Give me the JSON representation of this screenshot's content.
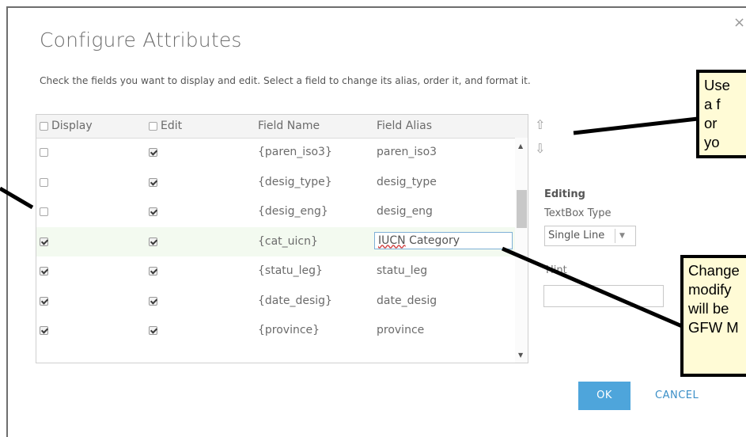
{
  "dialog": {
    "title": "Configure Attributes",
    "close_glyph": "×",
    "instructions": "Check the fields you want to display and edit. Select a field to change its alias, order it, and format it."
  },
  "grid": {
    "headers": {
      "display": "Display",
      "edit": "Edit",
      "field_name": "Field Name",
      "field_alias": "Field Alias"
    },
    "header_checks": {
      "display": false,
      "edit": false
    },
    "rows": [
      {
        "display": false,
        "edit": true,
        "field_name": "{paren_iso3}",
        "field_alias": "paren_iso3"
      },
      {
        "display": false,
        "edit": true,
        "field_name": "{desig_type}",
        "field_alias": "desig_type"
      },
      {
        "display": false,
        "edit": true,
        "field_name": "{desig_eng}",
        "field_alias": "desig_eng"
      },
      {
        "display": true,
        "edit": true,
        "field_name": "{cat_uicn}",
        "field_alias": "IUCN Category",
        "selected": true
      },
      {
        "display": true,
        "edit": true,
        "field_name": "{statu_leg}",
        "field_alias": "statu_leg"
      },
      {
        "display": true,
        "edit": true,
        "field_name": "{date_desig}",
        "field_alias": "date_desig"
      },
      {
        "display": true,
        "edit": true,
        "field_name": "{province}",
        "field_alias": "province"
      }
    ],
    "alias_edit": {
      "underlined": "IUCN",
      "rest": " Category"
    }
  },
  "side": {
    "move_up_glyph": "⇧",
    "move_down_glyph": "⇩",
    "editing_label": "Editing",
    "textbox_type_label": "TextBox Type",
    "textbox_type_value": "Single Line",
    "hint_label": "Hint"
  },
  "footer": {
    "ok_label": "OK",
    "cancel_label": "CANCEL"
  },
  "callouts": {
    "top_lines": [
      "Use",
      "a f",
      "or",
      "yo"
    ],
    "bottom_lines": [
      "Change",
      "modify",
      "will be",
      "GFW M"
    ]
  },
  "colors": {
    "primary_button": "#4ea5db",
    "link": "#3b8fc7",
    "callout_bg": "#fffbd6",
    "selected_row": "#f3faf0"
  }
}
